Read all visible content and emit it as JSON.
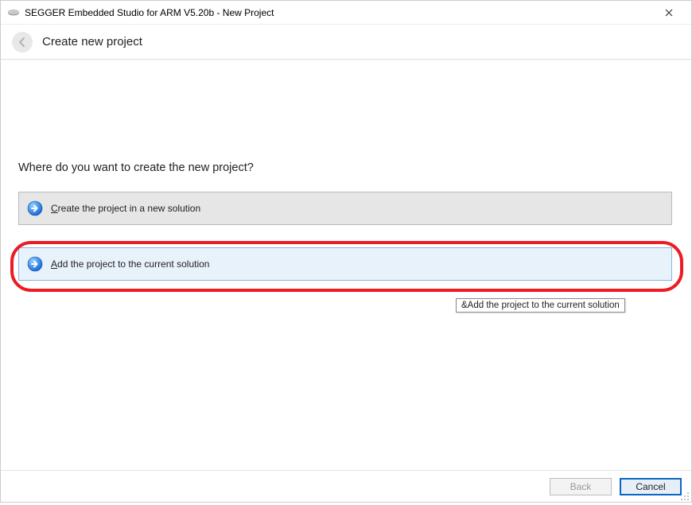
{
  "window": {
    "title": "SEGGER Embedded Studio for ARM V5.20b - New Project"
  },
  "header": {
    "page_title": "Create new project"
  },
  "main": {
    "question": "Where do you want to create the new project?",
    "option1": {
      "accel": "C",
      "rest": "reate the project in a new solution"
    },
    "option2": {
      "accel": "A",
      "rest": "dd the project to the current solution"
    },
    "tooltip": "&Add the project to the current solution"
  },
  "footer": {
    "back": "Back",
    "cancel": "Cancel"
  }
}
